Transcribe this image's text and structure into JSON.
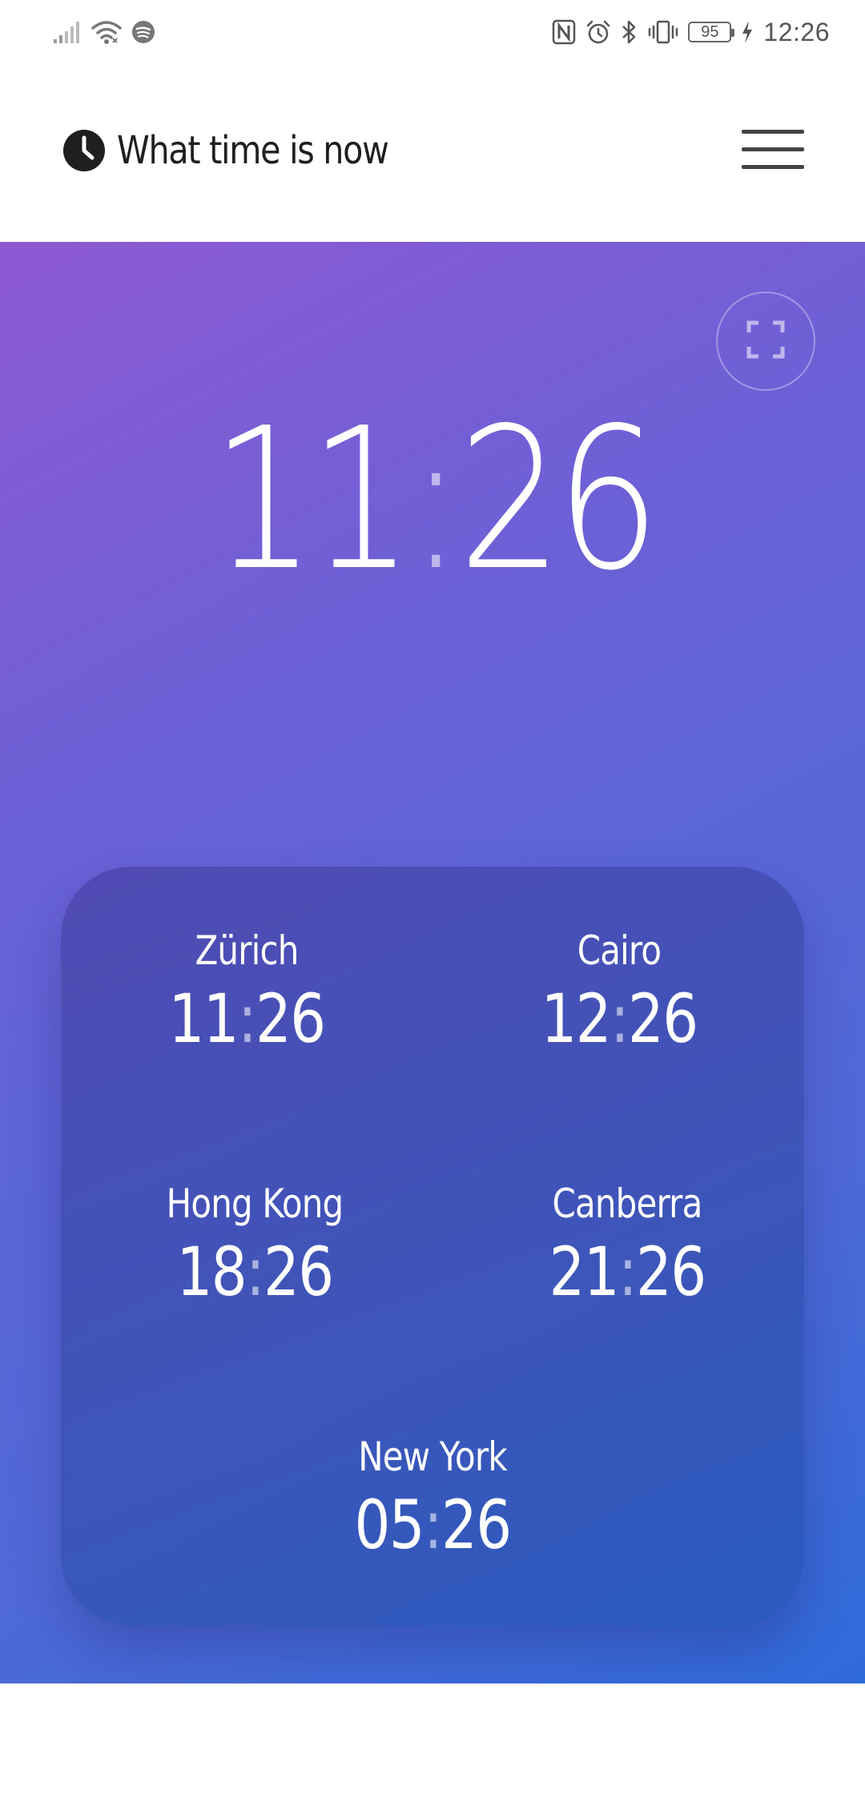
{
  "status_bar": {
    "time": "12:26",
    "battery": "95",
    "left_icons": [
      "signal-icon",
      "wifi-icon",
      "spotify-icon"
    ],
    "right_icons": [
      "nfc-icon",
      "alarm-icon",
      "bluetooth-icon",
      "vibrate-icon",
      "battery-icon",
      "charging-icon"
    ]
  },
  "header": {
    "title": "What time is now",
    "logo_icon": "clock-icon",
    "menu_icon": "hamburger-menu-icon"
  },
  "main_clock": {
    "hours": "11",
    "separator": ":",
    "minutes": "26",
    "fullscreen_icon": "fullscreen-icon"
  },
  "world_clocks": [
    {
      "city": "Zürich",
      "hours": "11",
      "minutes": "26"
    },
    {
      "city": "Cairo",
      "hours": "12",
      "minutes": "26"
    },
    {
      "city": "Hong Kong",
      "hours": "18",
      "minutes": "26"
    },
    {
      "city": "Canberra",
      "hours": "21",
      "minutes": "26"
    },
    {
      "city": "New York",
      "hours": "05",
      "minutes": "26"
    }
  ],
  "colors": {
    "gradient_start": "#8e5ad3",
    "gradient_end": "#2f6ad9",
    "text_on_gradient": "#ffffff"
  }
}
